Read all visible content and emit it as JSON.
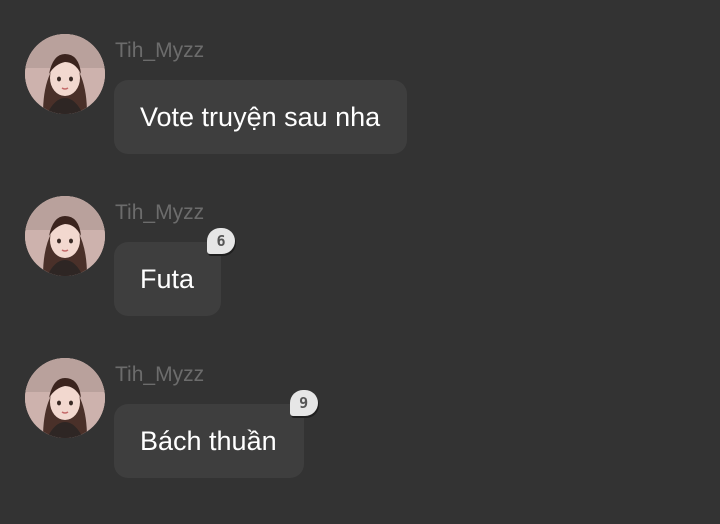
{
  "messages": [
    {
      "username": "Tih_Myzz",
      "avatar_icon": "user-avatar-girl",
      "text": "Vote truyện sau nha",
      "reaction_count": null
    },
    {
      "username": "Tih_Myzz",
      "avatar_icon": "user-avatar-girl",
      "text": "Futa",
      "reaction_count": "6"
    },
    {
      "username": "Tih_Myzz",
      "avatar_icon": "user-avatar-girl",
      "text": "Bách thuần",
      "reaction_count": "9"
    }
  ],
  "colors": {
    "background": "#333333",
    "bubble": "#3e3e3e",
    "username": "#6c6c6c",
    "message_text": "#ffffff",
    "badge": "#e6e6e6"
  }
}
